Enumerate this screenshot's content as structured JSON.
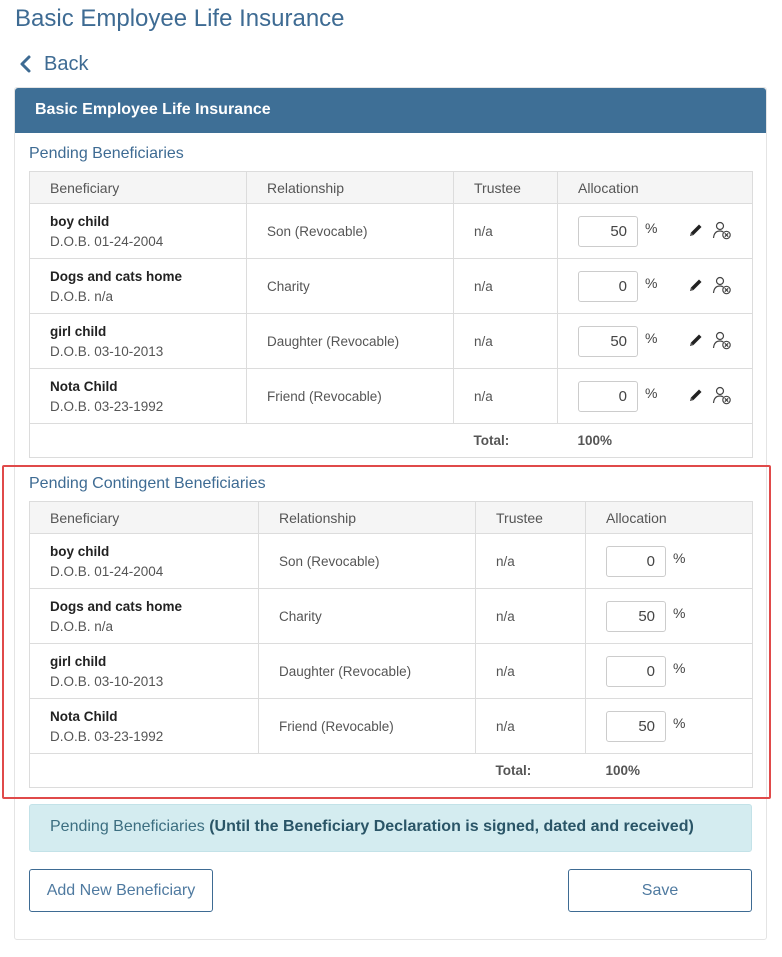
{
  "page": {
    "title": "Basic Employee Life Insurance",
    "back_label": "Back"
  },
  "panel": {
    "header": "Basic Employee Life Insurance"
  },
  "columns": {
    "beneficiary": "Beneficiary",
    "relationship": "Relationship",
    "trustee": "Trustee",
    "allocation": "Allocation"
  },
  "pending": {
    "title": "Pending Beneficiaries",
    "rows": [
      {
        "name": "boy child",
        "dob": "D.O.B. 01-24-2004",
        "relationship": "Son (Revocable)",
        "trustee": "n/a",
        "allocation": "50",
        "pct": "%"
      },
      {
        "name": "Dogs and cats home",
        "dob": "D.O.B. n/a",
        "relationship": "Charity",
        "trustee": "n/a",
        "allocation": "0",
        "pct": "%"
      },
      {
        "name": "girl child",
        "dob": "D.O.B. 03-10-2013",
        "relationship": "Daughter (Revocable)",
        "trustee": "n/a",
        "allocation": "50",
        "pct": "%"
      },
      {
        "name": "Nota Child",
        "dob": "D.O.B. 03-23-1992",
        "relationship": "Friend (Revocable)",
        "trustee": "n/a",
        "allocation": "0",
        "pct": "%"
      }
    ],
    "total_label": "Total:",
    "total_value": "100%"
  },
  "contingent": {
    "title": "Pending Contingent Beneficiaries",
    "rows": [
      {
        "name": "boy child",
        "dob": "D.O.B. 01-24-2004",
        "relationship": "Son (Revocable)",
        "trustee": "n/a",
        "allocation": "0",
        "pct": "%"
      },
      {
        "name": "Dogs and cats home",
        "dob": "D.O.B. n/a",
        "relationship": "Charity",
        "trustee": "n/a",
        "allocation": "50",
        "pct": "%"
      },
      {
        "name": "girl child",
        "dob": "D.O.B. 03-10-2013",
        "relationship": "Daughter (Revocable)",
        "trustee": "n/a",
        "allocation": "0",
        "pct": "%"
      },
      {
        "name": "Nota Child",
        "dob": "D.O.B. 03-23-1992",
        "relationship": "Friend (Revocable)",
        "trustee": "n/a",
        "allocation": "50",
        "pct": "%"
      }
    ],
    "total_label": "Total:",
    "total_value": "100%"
  },
  "info": {
    "lead": "Pending Beneficiaries",
    "bold": "(Until the Beneficiary Declaration is signed, dated and received)"
  },
  "buttons": {
    "add": "Add New Beneficiary",
    "save": "Save"
  },
  "icons": {
    "back": "chevron-left-icon",
    "edit": "pencil-icon",
    "remove": "remove-person-icon"
  },
  "colors": {
    "primary": "#3e6f96",
    "highlight": "#e04a4a",
    "info_bg": "#d4ecf0"
  }
}
